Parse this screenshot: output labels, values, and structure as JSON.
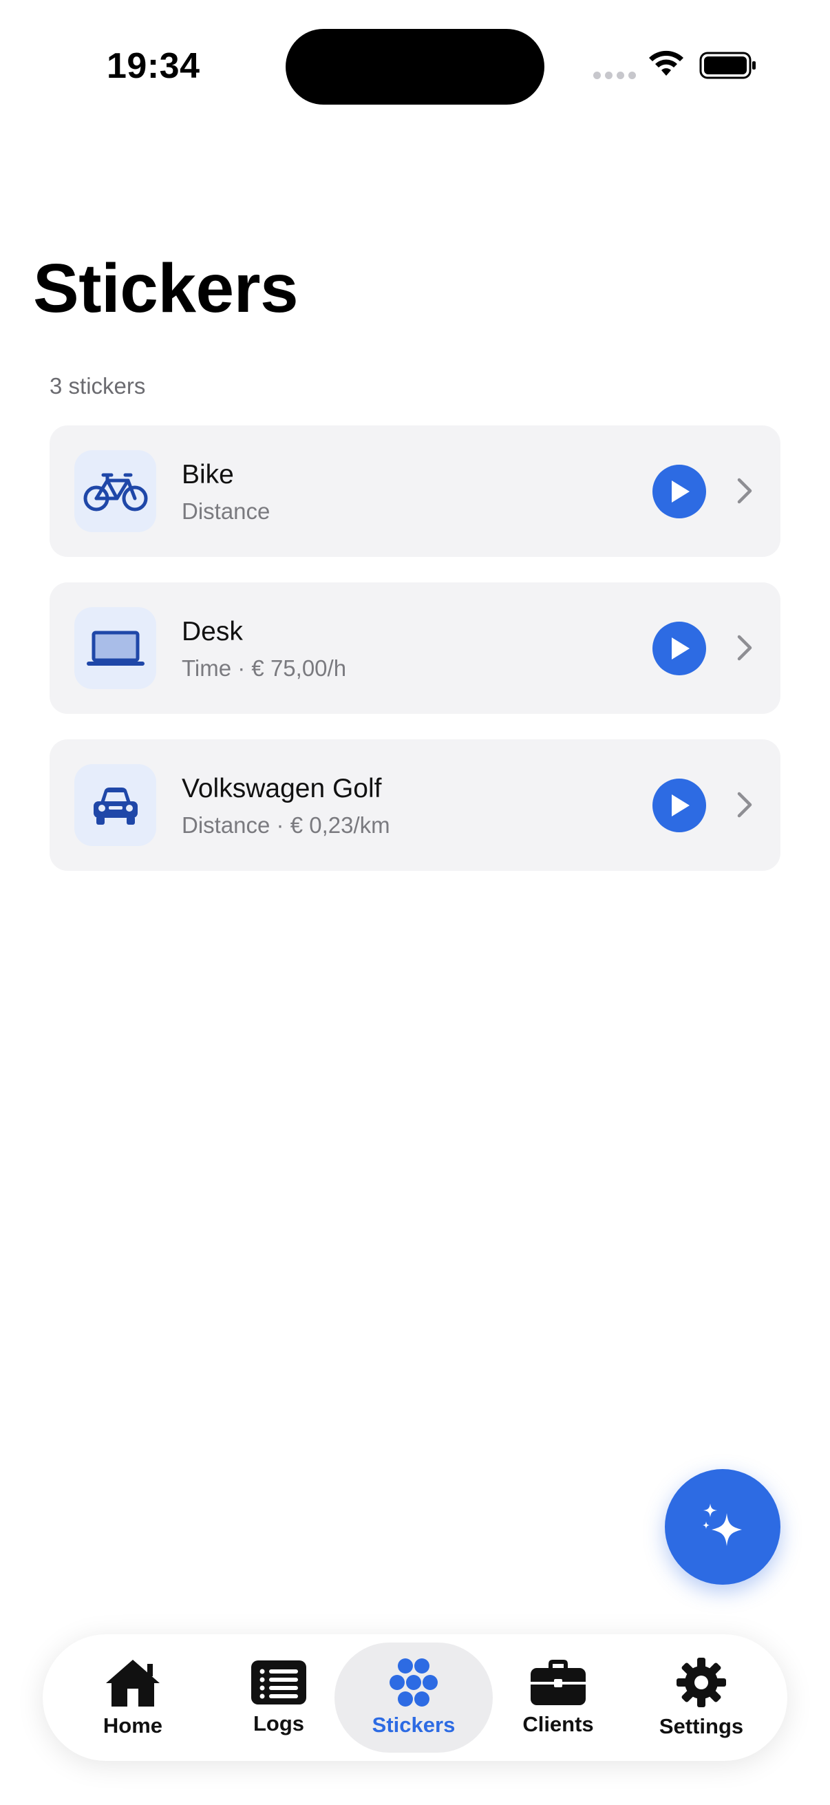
{
  "status_bar": {
    "time": "19:34"
  },
  "header": {
    "title": "Stickers",
    "count": "3 stickers"
  },
  "stickers": [
    {
      "title": "Bike",
      "subtitle": "Distance",
      "icon": "bike-icon"
    },
    {
      "title": "Desk",
      "subtitle": "Time · € 75,00/h",
      "icon": "laptop-icon"
    },
    {
      "title": "Volkswagen Golf",
      "subtitle": "Distance · € 0,23/km",
      "icon": "car-icon"
    }
  ],
  "fab": {
    "icon": "sparkles-icon"
  },
  "tabs": [
    {
      "label": "Home",
      "icon": "house-icon"
    },
    {
      "label": "Logs",
      "icon": "list-icon"
    },
    {
      "label": "Stickers",
      "icon": "dots-cluster-icon",
      "active": true
    },
    {
      "label": "Clients",
      "icon": "briefcase-icon"
    },
    {
      "label": "Settings",
      "icon": "gear-icon"
    }
  ],
  "colors": {
    "accent": "#2d6be3",
    "card_bg": "#f3f3f5",
    "icon_tile_bg": "#e6edfb",
    "icon_color": "#1f47a8"
  }
}
